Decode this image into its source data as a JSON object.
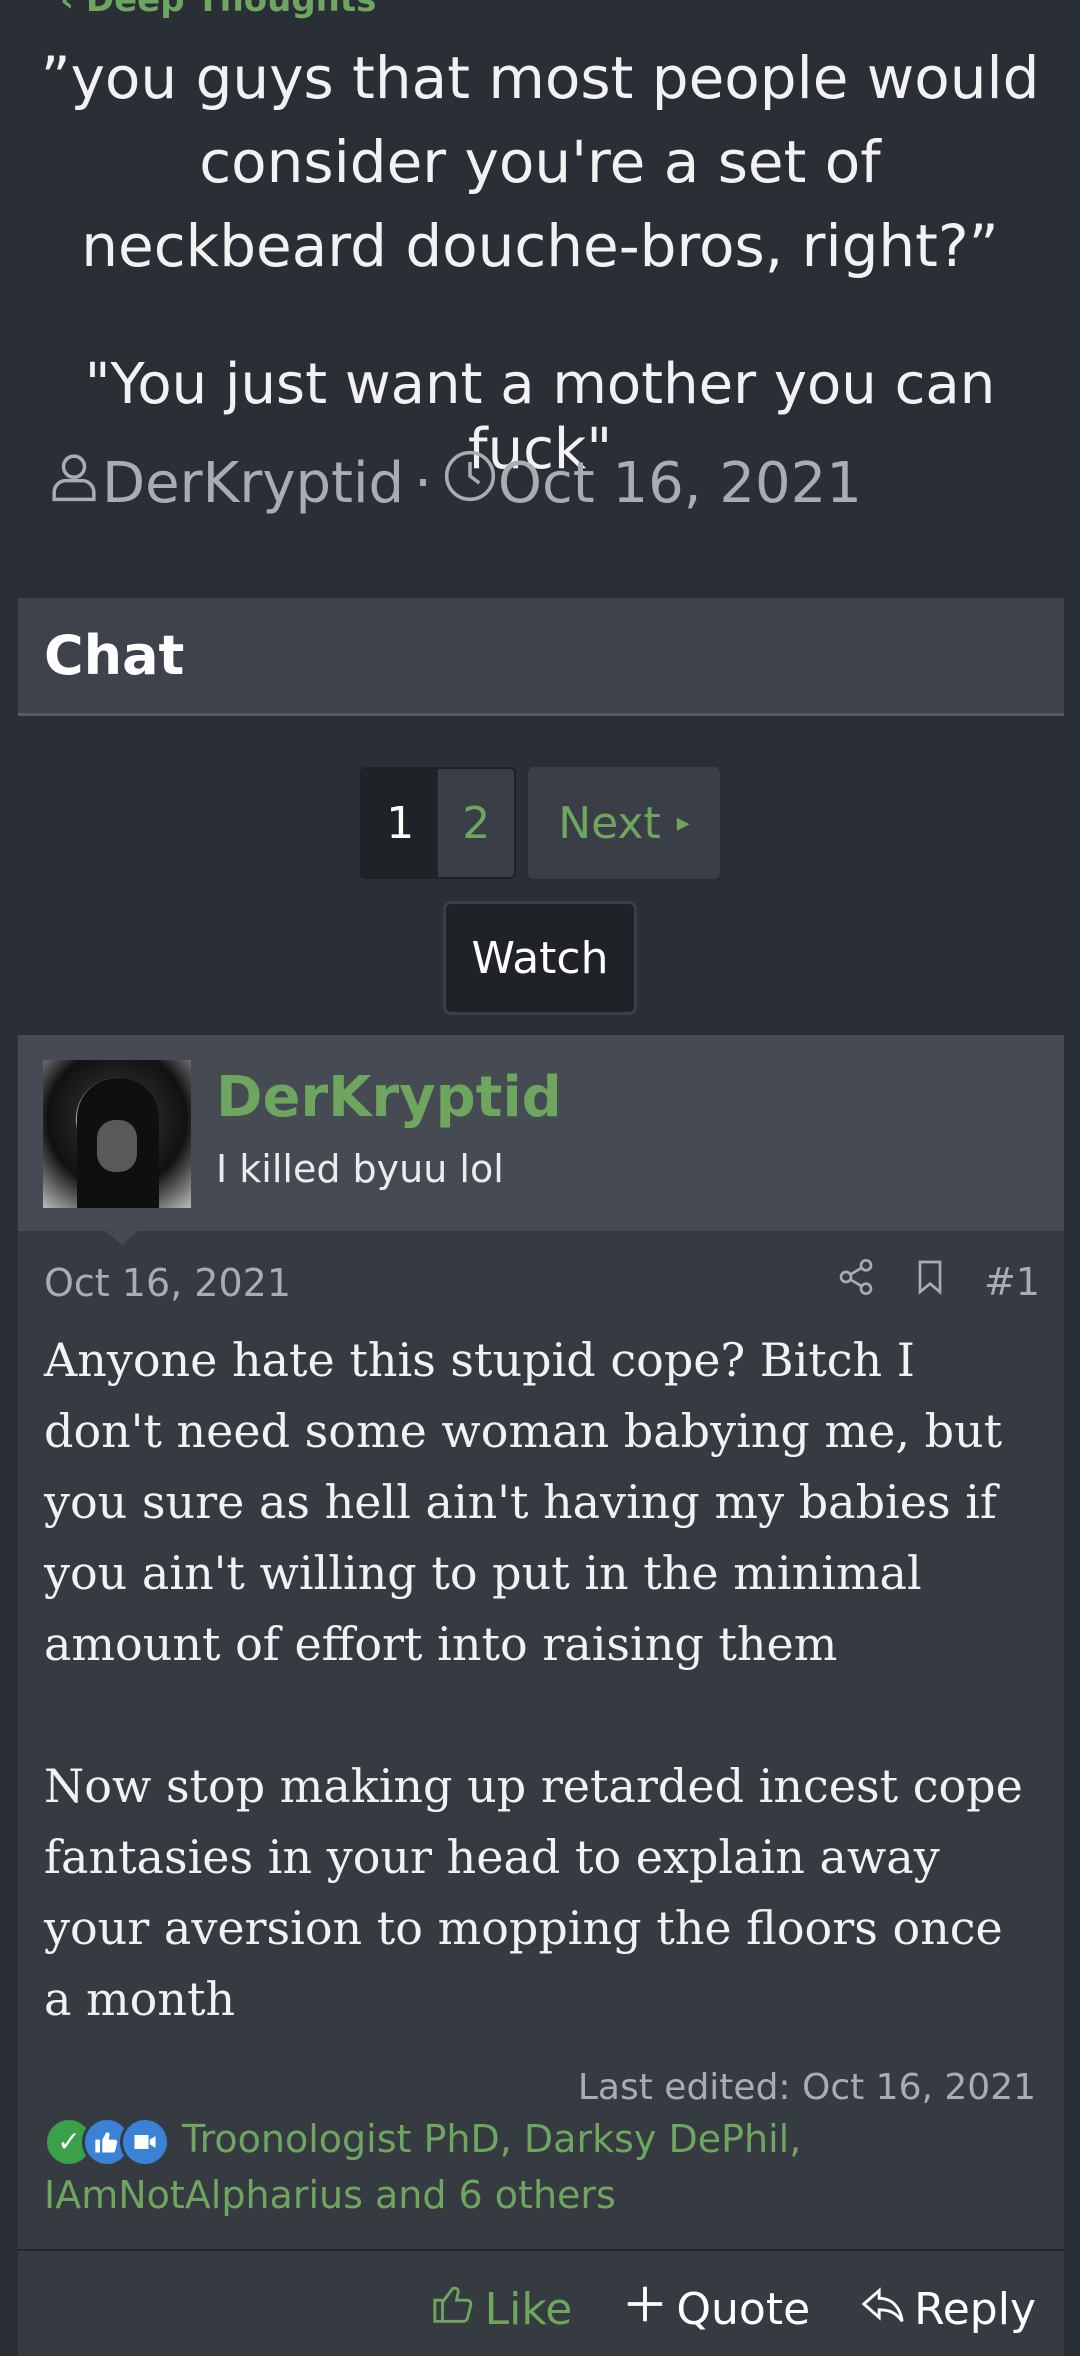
{
  "breadcrumb": {
    "label": "Deep Thoughts"
  },
  "thread": {
    "title": "”you guys that most people would consider you're a set of neckbeard douche-bros, right?”",
    "subtitle": "\"You just want a mother you can fuck\"",
    "author": "DerKryptid",
    "separator": "·",
    "date": "Oct 16, 2021"
  },
  "section": {
    "title": "Chat"
  },
  "pagination": {
    "pages": [
      "1",
      "2"
    ],
    "current": "1",
    "next_label": "Next",
    "next_caret": "▸"
  },
  "watch": {
    "label": "Watch"
  },
  "post": {
    "username": "DerKryptid",
    "user_title": "I killed byuu lol",
    "date": "Oct 16, 2021",
    "number": "#1",
    "paragraphs": [
      "Anyone hate this stupid cope? Bitch I don't need some woman babying me, but you sure as hell ain't having my babies if you ain't willing to put in the minimal amount of effort into raising them",
      "Now stop making up retarded incest cope fantasies in your head to explain away your aversion to mopping the floors once a month"
    ],
    "last_edited": "Last edited: Oct 16, 2021",
    "reactions": {
      "icons": [
        "check-reaction-icon",
        "like-reaction-icon",
        "reaction-icon"
      ],
      "text": "Troonologist PhD, Darksy DePhil, IAmNotAlpharius and 6 others"
    },
    "actions": {
      "like": "Like",
      "quote": "Quote",
      "reply": "Reply"
    }
  },
  "colors": {
    "background": "#2a2f36",
    "accent": "#6ea55f",
    "panel": "#363b42"
  }
}
